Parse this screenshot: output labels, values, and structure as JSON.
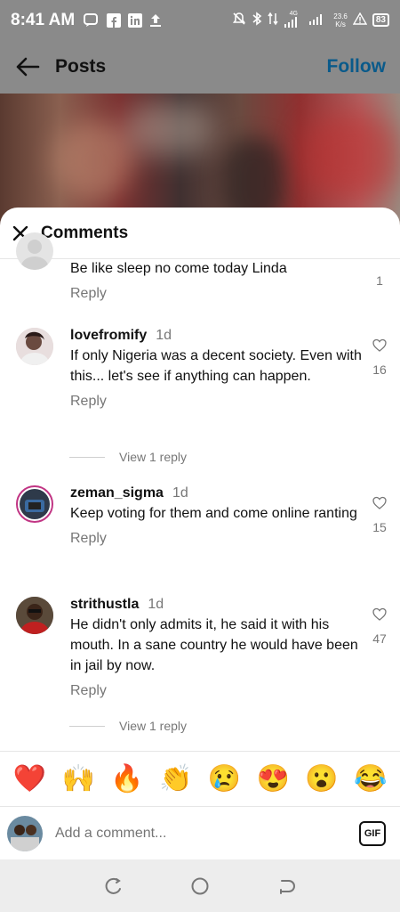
{
  "status_bar": {
    "time": "8:41 AM",
    "net_speed_value": "23.6",
    "net_speed_unit": "K/s",
    "network": "4G",
    "battery": "83"
  },
  "header": {
    "title": "Posts",
    "follow_label": "Follow"
  },
  "sheet": {
    "title": "Comments"
  },
  "comments": [
    {
      "username": "",
      "time": "",
      "text": "Be like sleep no come today Linda",
      "reply_label": "Reply",
      "likes": "1"
    },
    {
      "username": "lovefromify",
      "time": "1d",
      "text": "If only Nigeria was a decent society. Even with this... let's see if anything can happen.",
      "reply_label": "Reply",
      "likes": "16",
      "view_replies": "View 1 reply"
    },
    {
      "username": "zeman_sigma",
      "time": "1d",
      "text": "Keep voting for them and come online ranting",
      "reply_label": "Reply",
      "likes": "15"
    },
    {
      "username": "strithustla",
      "time": "1d",
      "text": "He didn't only admits it, he said it with his mouth. In a sane country he would have been in jail by now.",
      "reply_label": "Reply",
      "likes": "47",
      "view_replies": "View 1 reply"
    }
  ],
  "emoji_bar": [
    "❤️",
    "🙌",
    "🔥",
    "👏",
    "😢",
    "😍",
    "😮",
    "😂"
  ],
  "composer": {
    "placeholder": "Add a comment...",
    "gif_label": "GIF"
  },
  "colors": {
    "follow": "#0a5a8a",
    "overlay": "#8a8a8a"
  }
}
